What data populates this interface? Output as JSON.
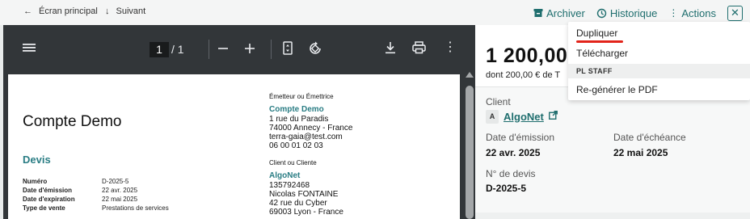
{
  "topbar": {
    "back_label": "Écran principal",
    "back_icon": "arrow-left-icon",
    "next_label": "Suivant",
    "next_icon": "arrow-down-icon",
    "archive_label": "Archiver",
    "history_label": "Historique",
    "actions_label": "Actions",
    "close_label": "✕"
  },
  "viewer": {
    "page_current": "1",
    "page_sep": "/ 1"
  },
  "document": {
    "title": "Compte Demo",
    "type": "Devis",
    "meta": [
      {
        "key": "Numéro",
        "value": "D-2025-5"
      },
      {
        "key": "Date d'émission",
        "value": "22 avr. 2025"
      },
      {
        "key": "Date d'expiration",
        "value": "22 mai 2025"
      },
      {
        "key": "Type de vente",
        "value": "Prestations de services"
      }
    ],
    "emitter_label": "Émetteur ou Émettrice",
    "emitter_name": "Compte Demo",
    "emitter_lines": [
      "1 rue du Paradis",
      "74000 Annecy - France",
      "terra-gaia@test.com",
      "06 00 01 02 03"
    ],
    "client_label": "Client ou Cliente",
    "client_name": "AlgoNet",
    "client_lines": [
      "135792468",
      "Nicolas FONTAINE",
      "42 rue du Cyber",
      "69003 Lyon - France"
    ]
  },
  "panel": {
    "amount": "1 200,00",
    "tax": "dont 200,00 € de T",
    "client_label": "Client",
    "client_avatar": "A",
    "client_name": "AlgoNet",
    "issue_label": "Date d'émission",
    "issue_value": "22 avr. 2025",
    "due_label": "Date d'échéance",
    "due_value": "22 mai 2025",
    "number_label": "N° de devis",
    "number_value": "D-2025-5"
  },
  "menu": {
    "items": [
      "Dupliquer",
      "Télécharger"
    ],
    "section": "PL STAFF",
    "staff_items": [
      "Re-générer le PDF"
    ]
  },
  "colors": {
    "accent": "#1f6e6e",
    "doc_accent": "#2a7d84",
    "viewer_bg": "#323639",
    "highlight": "#e2231a"
  }
}
